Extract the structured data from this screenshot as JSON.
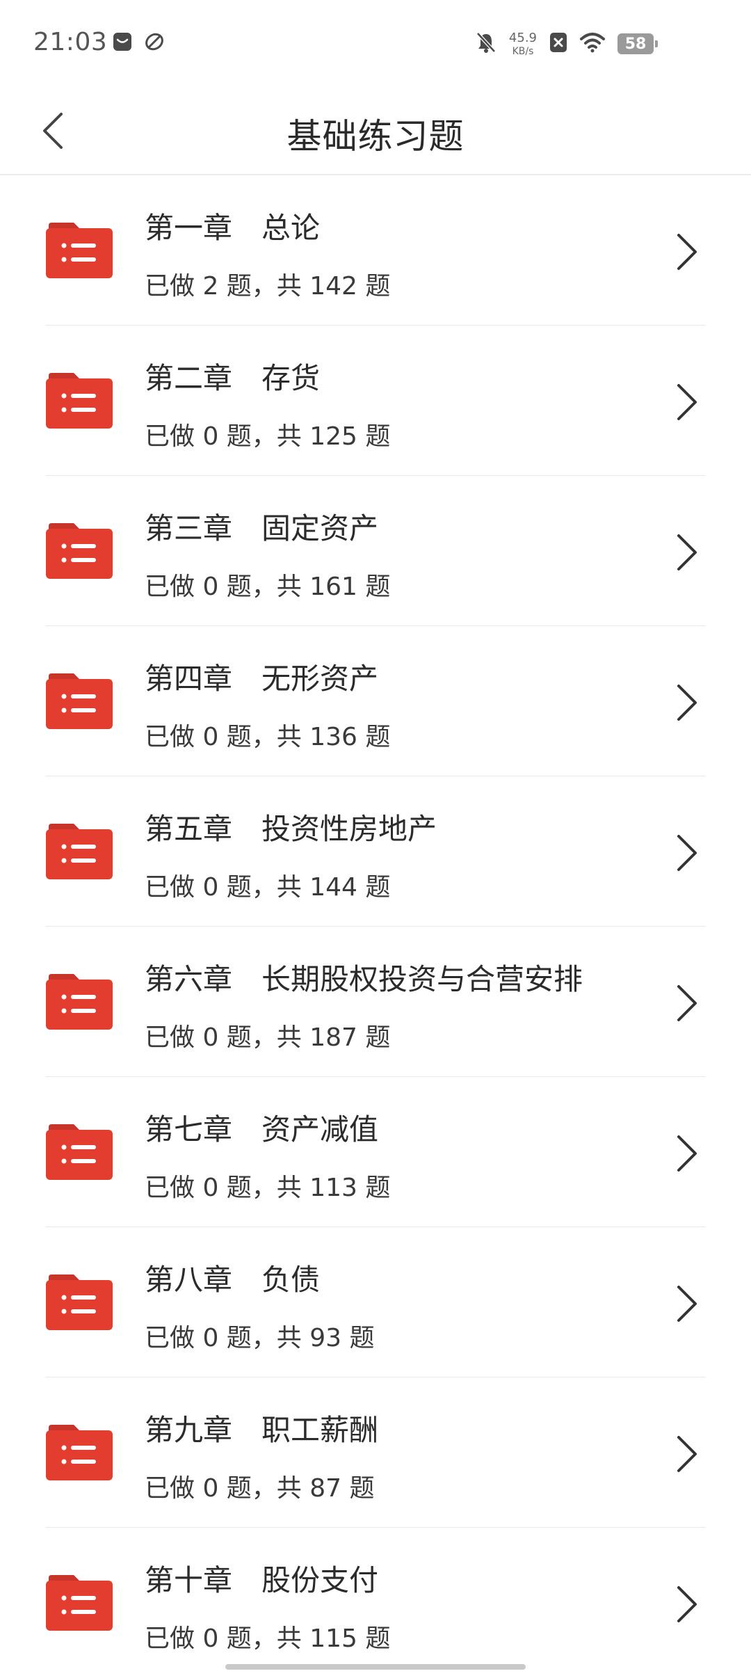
{
  "status_bar": {
    "time": "21:03",
    "net_speed_value": "45.9",
    "net_speed_unit": "KB/s",
    "battery_level": "58",
    "icons": [
      "message-icon",
      "leaf-app-icon",
      "bell-off-icon",
      "close-box-icon",
      "wifi-icon",
      "battery-icon"
    ]
  },
  "header": {
    "title": "基础练习题",
    "back_icon": "chevron-left-icon"
  },
  "colors": {
    "folder_icon": "#e23d2f",
    "folder_tab": "#c8332a",
    "separator": "#eaeaea",
    "chevron": "#333333"
  },
  "chapters": [
    {
      "title": "第一章　总论",
      "done": 2,
      "total": 142,
      "progress": "已做 2 题，共 142 题"
    },
    {
      "title": "第二章　存货",
      "done": 0,
      "total": 125,
      "progress": "已做 0 题，共 125 题"
    },
    {
      "title": "第三章　固定资产",
      "done": 0,
      "total": 161,
      "progress": "已做 0 题，共 161 题"
    },
    {
      "title": "第四章　无形资产",
      "done": 0,
      "total": 136,
      "progress": "已做 0 题，共 136 题"
    },
    {
      "title": "第五章　投资性房地产",
      "done": 0,
      "total": 144,
      "progress": "已做 0 题，共 144 题"
    },
    {
      "title": "第六章　长期股权投资与合营安排",
      "done": 0,
      "total": 187,
      "progress": "已做 0 题，共 187 题"
    },
    {
      "title": "第七章　资产减值",
      "done": 0,
      "total": 113,
      "progress": "已做 0 题，共 113 题"
    },
    {
      "title": "第八章　负债",
      "done": 0,
      "total": 93,
      "progress": "已做 0 题，共 93 题"
    },
    {
      "title": "第九章　职工薪酬",
      "done": 0,
      "total": 87,
      "progress": "已做 0 题，共 87 题"
    },
    {
      "title": "第十章　股份支付",
      "done": 0,
      "total": 115,
      "progress": "已做 0 题，共 115 题"
    }
  ]
}
